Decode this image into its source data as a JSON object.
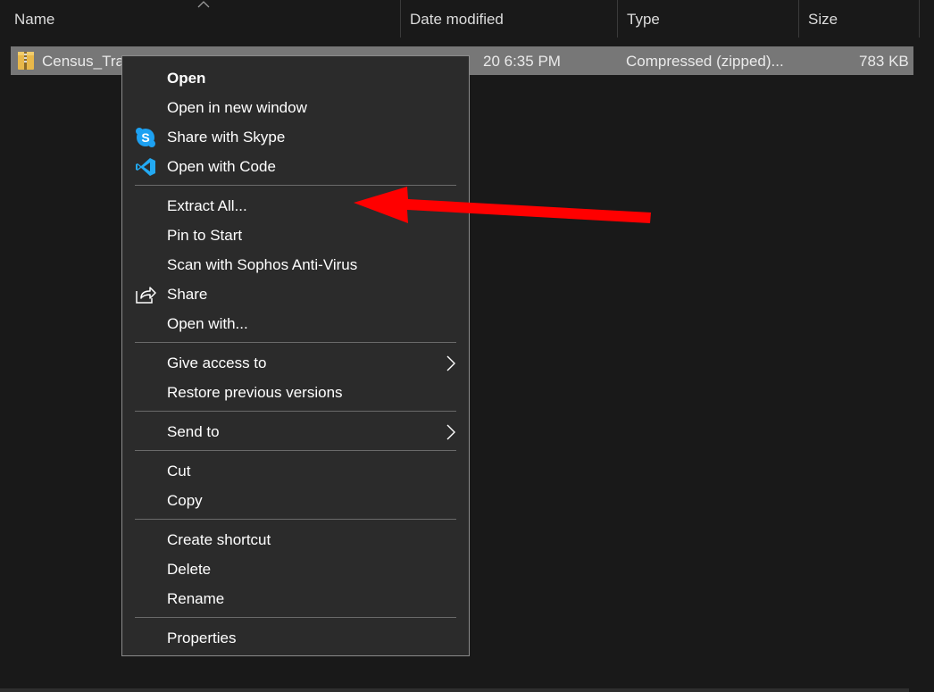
{
  "columns": {
    "name": "Name",
    "date_modified": "Date modified",
    "type": "Type",
    "size": "Size"
  },
  "file": {
    "name": "Census_Tra",
    "date_modified": "20 6:35 PM",
    "type": "Compressed (zipped)...",
    "size": "783 KB",
    "icon": "zip-folder-icon"
  },
  "context_menu": {
    "items": [
      {
        "label": "Open",
        "bold": true
      },
      {
        "label": "Open in new window"
      },
      {
        "label": "Share with Skype",
        "icon": "skype-icon"
      },
      {
        "label": "Open with Code",
        "icon": "vscode-icon"
      },
      {
        "label": "Extract All..."
      },
      {
        "label": "Pin to Start"
      },
      {
        "label": "Scan with Sophos Anti-Virus"
      },
      {
        "label": "Share",
        "icon": "share-icon"
      },
      {
        "label": "Open with..."
      },
      {
        "label": "Give access to",
        "submenu": true
      },
      {
        "label": "Restore previous versions"
      },
      {
        "label": "Send to",
        "submenu": true
      },
      {
        "label": "Cut"
      },
      {
        "label": "Copy"
      },
      {
        "label": "Create shortcut"
      },
      {
        "label": "Delete"
      },
      {
        "label": "Rename"
      },
      {
        "label": "Properties"
      }
    ]
  },
  "annotation": {
    "type": "arrow",
    "color": "#ff0000",
    "points_to": "Extract All..."
  },
  "colors": {
    "background": "#191919",
    "menu_background": "#2b2b2b",
    "selection": "#777777",
    "arrow": "#ff0000"
  }
}
